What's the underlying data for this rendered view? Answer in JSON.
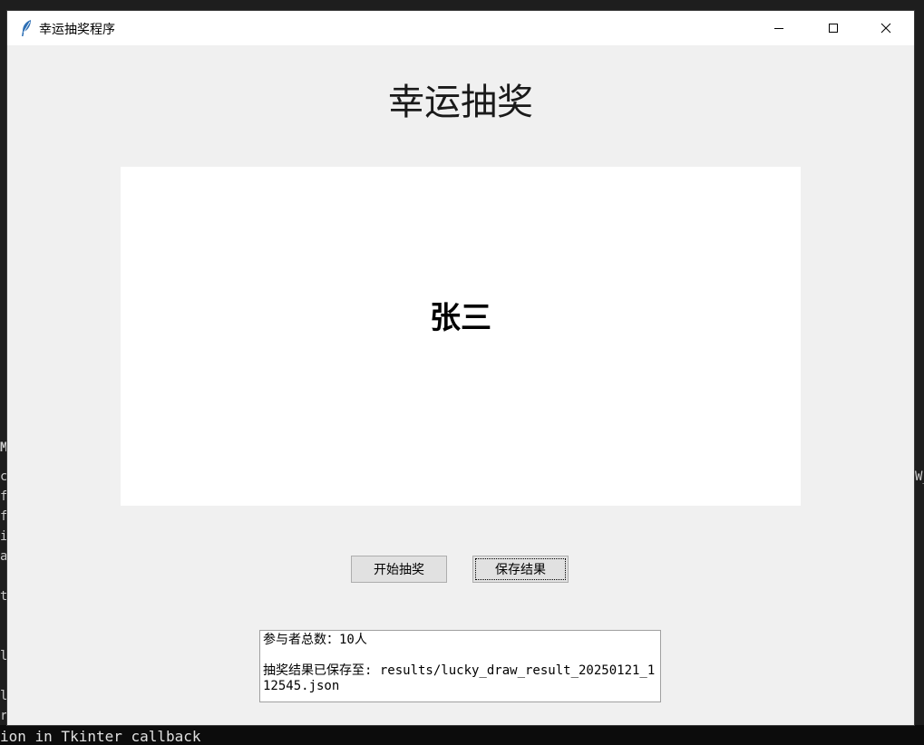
{
  "window": {
    "title": "幸运抽奖程序",
    "icon": "feather-icon"
  },
  "main": {
    "heading": "幸运抽奖",
    "winner_name": "张三"
  },
  "buttons": {
    "start_label": "开始抽奖",
    "save_label": "保存结果"
  },
  "log": {
    "participants": "参与者总数：10人",
    "saved_path": "抽奖结果已保存至: results/lucky_draw_result_20250121_112545.json"
  },
  "background": {
    "terminal_bottom": "ion in Tkinter callback",
    "left_chars": [
      "M",
      "c",
      "f",
      "f",
      "i",
      "a",
      "t",
      "l",
      "l",
      "r"
    ],
    "right_fragment": "W_"
  }
}
